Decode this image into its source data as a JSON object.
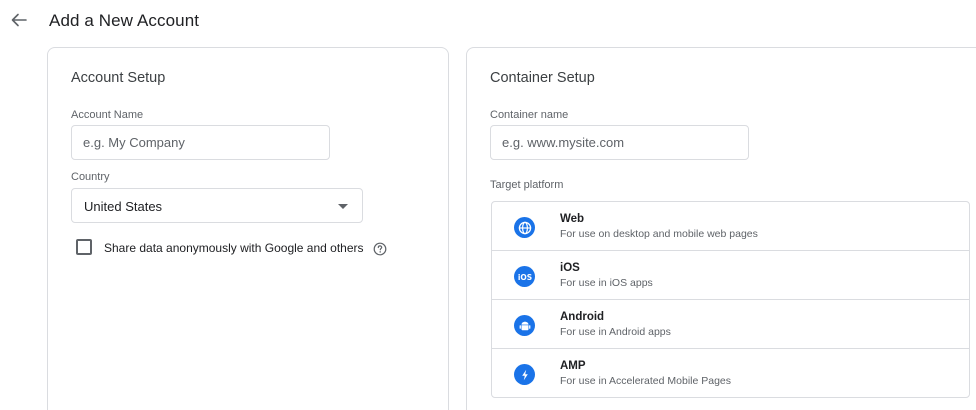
{
  "header": {
    "title": "Add a New Account"
  },
  "account_setup": {
    "title": "Account Setup",
    "account_name_label": "Account Name",
    "account_name_placeholder": "e.g. My Company",
    "country_label": "Country",
    "country_value": "United States",
    "share_data_label": "Share data anonymously with Google and others",
    "share_data_checked": false
  },
  "container_setup": {
    "title": "Container Setup",
    "container_name_label": "Container name",
    "container_name_placeholder": "e.g. www.mysite.com",
    "target_platform_label": "Target platform",
    "platforms": [
      {
        "name": "Web",
        "description": "For use on desktop and mobile web pages",
        "icon": "globe-icon"
      },
      {
        "name": "iOS",
        "description": "For use in iOS apps",
        "icon": "ios-icon"
      },
      {
        "name": "Android",
        "description": "For use in Android apps",
        "icon": "android-icon"
      },
      {
        "name": "AMP",
        "description": "For use in Accelerated Mobile Pages",
        "icon": "amp-bolt-icon"
      }
    ]
  },
  "colors": {
    "accent": "#1a73e8",
    "border": "#dadce0",
    "text_primary": "#202124",
    "text_secondary": "#5f6368"
  }
}
